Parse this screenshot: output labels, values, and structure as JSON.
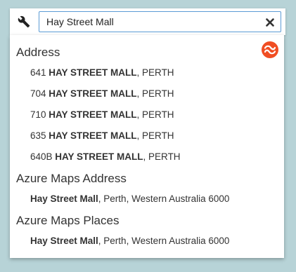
{
  "search": {
    "value": "Hay Street Mall"
  },
  "icons": {
    "tool": "wrench-icon",
    "clear": "close-icon",
    "brand": "provider-logo-icon"
  },
  "colors": {
    "background": "#b7d3d7",
    "input_border": "#5b9bd5",
    "brand": "#f04e23"
  },
  "groups": [
    {
      "title": "Address",
      "items": [
        {
          "prefix": "641 ",
          "match": "HAY STREET MALL",
          "suffix": ", PERTH"
        },
        {
          "prefix": "704 ",
          "match": "HAY STREET MALL",
          "suffix": ", PERTH"
        },
        {
          "prefix": "710 ",
          "match": "HAY STREET MALL",
          "suffix": ", PERTH"
        },
        {
          "prefix": "635 ",
          "match": "HAY STREET MALL",
          "suffix": ", PERTH"
        },
        {
          "prefix": "640B ",
          "match": "HAY STREET MALL",
          "suffix": ", PERTH"
        }
      ]
    },
    {
      "title": "Azure Maps Address",
      "items": [
        {
          "prefix": "",
          "match": "Hay Street Mall",
          "suffix": ", Perth, Western Australia 6000"
        }
      ]
    },
    {
      "title": "Azure Maps Places",
      "items": [
        {
          "prefix": "",
          "match": "Hay Street Mall",
          "suffix": ", Perth, Western Australia 6000"
        }
      ]
    }
  ]
}
